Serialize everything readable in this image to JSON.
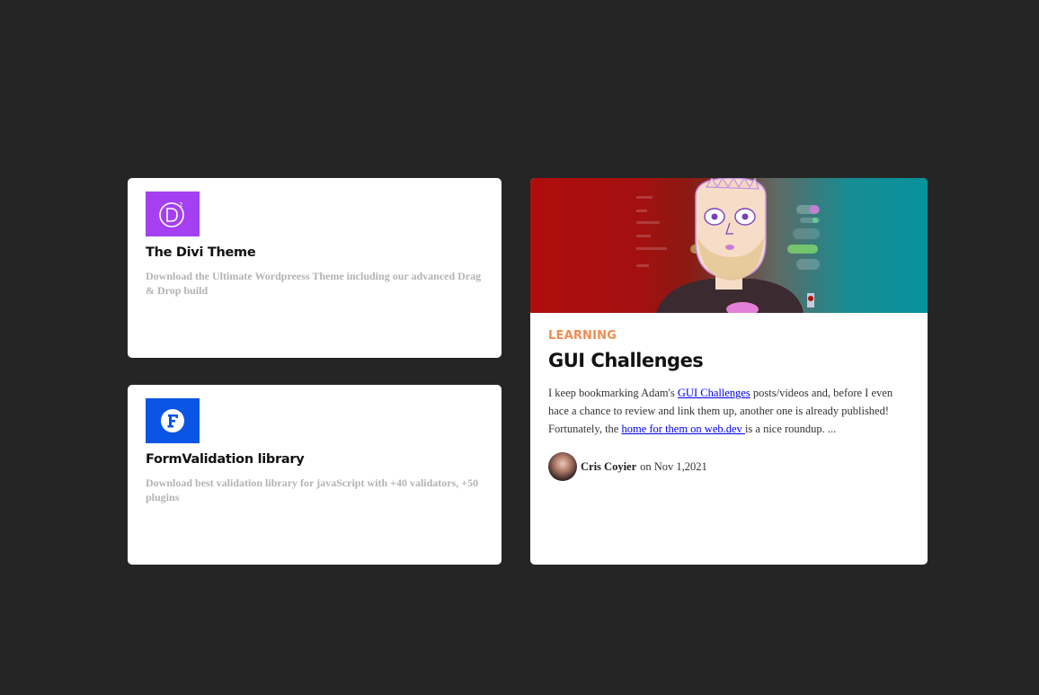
{
  "cards": [
    {
      "title": "The Divi Theme",
      "description": "Download the Ultimate Wordpreess Theme including our advanced Drag & Drop build",
      "logo_color": "#a43ff2",
      "icon": "divi-logo-icon"
    },
    {
      "title": "FormValidation library",
      "description": "Download best validation library for javaScript with +40 validators, +50 plugins",
      "logo_color": "#0b55e4",
      "icon": "formvalidation-logo-icon"
    }
  ],
  "article": {
    "category": "LEARNING",
    "title": "GUI Challenges",
    "excerpt_part1": "I keep bookmarking Adam's ",
    "link1_text": "GUI Challenges",
    "excerpt_part2": " posts/videos and, before I even hace a chance to review and link them up, another one is already published! Fortunately, the ",
    "link2_text": "home for them on web.dev ",
    "excerpt_part3": "is a nice roundup. ...",
    "author": "Cris Coyier",
    "date_prefix": "on",
    "date": "Nov 1,2021",
    "hero_colors": [
      "#b00d0d",
      "#06929c"
    ],
    "category_color": "#f08c4f"
  }
}
